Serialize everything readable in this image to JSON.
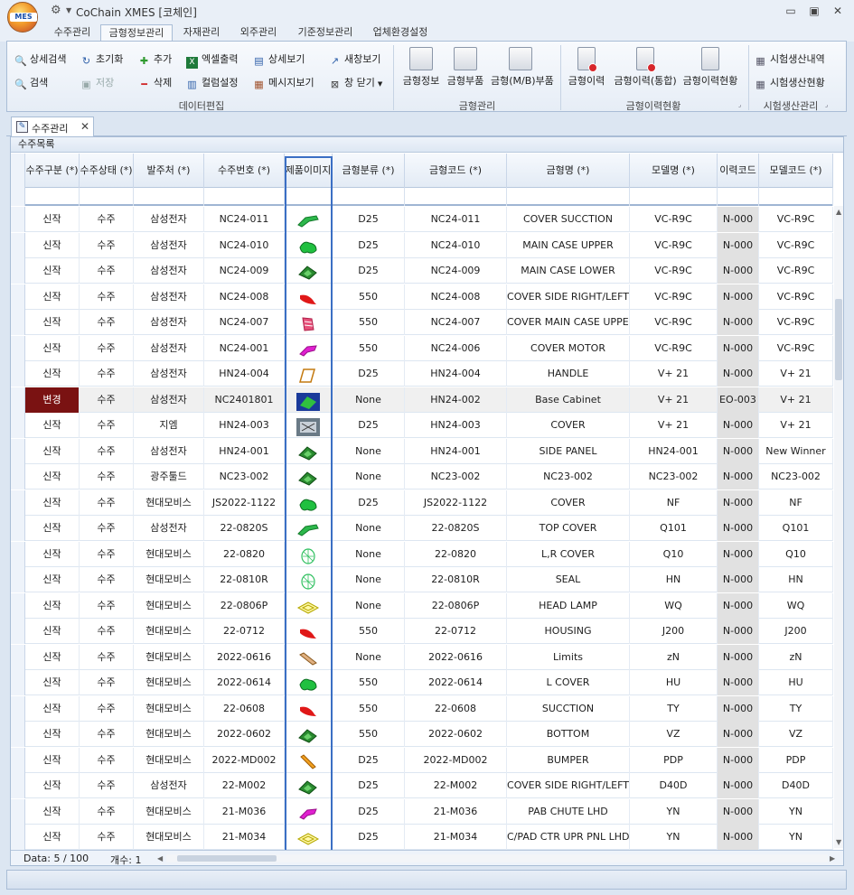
{
  "window": {
    "logo_text": "MES",
    "title": "CoChain XMES [코체인]"
  },
  "ribbon_tabs": [
    "수주관리",
    "금형정보관리",
    "자재관리",
    "외주관리",
    "기준정보관리",
    "업체환경설정"
  ],
  "ribbon": {
    "search_detail": "상세검색",
    "search": "검색",
    "reset": "초기화",
    "save": "저장",
    "add": "추가",
    "delete": "삭제",
    "excel_export": "엑셀출력",
    "column_settings": "컬럼설정",
    "detail_view": "상세보기",
    "message_view": "메시지보기",
    "new_window": "새창보기",
    "close_window": "창 닫기",
    "group_data_edit": "데이터편집",
    "mold_info": "금형정보",
    "mold_parts": "금형부품",
    "mold_mb_parts": "금형(M/B)부품",
    "group_mold_mgmt": "금형관리",
    "mold_history": "금형이력",
    "mold_history_integrated": "금형이력(통합)",
    "mold_history_status": "금형이력현황",
    "group_mold_history": "금형이력현황",
    "trial_production_log": "시험생산내역",
    "trial_production_status": "시험생산현황",
    "group_trial": "시험생산관리"
  },
  "doc_tab": {
    "label": "수주관리"
  },
  "panel": {
    "title": "수주목록"
  },
  "columns": [
    "수주구분 (*)",
    "수주상태 (*)",
    "발주처 (*)",
    "수주번호 (*)",
    "제품이미지",
    "금형분류 (*)",
    "금형코드 (*)",
    "금형명 (*)",
    "모델명 (*)",
    "이력코드",
    "모델코드 (*)"
  ],
  "rows": [
    {
      "type": "신작",
      "status": "수주",
      "client": "삼성전자",
      "order_no": "NC24-011",
      "image": "green-arm",
      "mold_class": "D25",
      "mold_code": "NC24-011",
      "mold_name": "COVER SUCCTION",
      "model": "VC-R9C",
      "history": "N-000",
      "model_code": "VC-R9C"
    },
    {
      "type": "신작",
      "status": "수주",
      "client": "삼성전자",
      "order_no": "NC24-010",
      "image": "green-blob",
      "mold_class": "D25",
      "mold_code": "NC24-010",
      "mold_name": "MAIN CASE UPPER",
      "model": "VC-R9C",
      "history": "N-000",
      "model_code": "VC-R9C"
    },
    {
      "type": "신작",
      "status": "수주",
      "client": "삼성전자",
      "order_no": "NC24-009",
      "image": "green-dark",
      "mold_class": "D25",
      "mold_code": "NC24-009",
      "mold_name": "MAIN CASE LOWER",
      "model": "VC-R9C",
      "history": "N-000",
      "model_code": "VC-R9C"
    },
    {
      "type": "신작",
      "status": "수주",
      "client": "삼성전자",
      "order_no": "NC24-008",
      "image": "red-part",
      "mold_class": "550",
      "mold_code": "NC24-008",
      "mold_name": "COVER SIDE RIGHT/LEFT",
      "model": "VC-R9C",
      "history": "N-000",
      "model_code": "VC-R9C"
    },
    {
      "type": "신작",
      "status": "수주",
      "client": "삼성전자",
      "order_no": "NC24-007",
      "image": "red-mesh",
      "mold_class": "550",
      "mold_code": "NC24-007",
      "mold_name": "COVER MAIN CASE UPPER",
      "model": "VC-R9C",
      "history": "N-000",
      "model_code": "VC-R9C"
    },
    {
      "type": "신작",
      "status": "수주",
      "client": "삼성전자",
      "order_no": "NC24-001",
      "image": "magenta",
      "mold_class": "550",
      "mold_code": "NC24-006",
      "mold_name": "COVER MOTOR",
      "model": "VC-R9C",
      "history": "N-000",
      "model_code": "VC-R9C"
    },
    {
      "type": "신작",
      "status": "수주",
      "client": "삼성전자",
      "order_no": "HN24-004",
      "image": "outline-orange",
      "mold_class": "D25",
      "mold_code": "HN24-004",
      "mold_name": "HANDLE",
      "model": "V+ 21",
      "history": "N-000",
      "model_code": "V+ 21"
    },
    {
      "type": "변경",
      "status": "수주",
      "client": "삼성전자",
      "order_no": "NC2401801",
      "image": "photo-blue",
      "mold_class": "None",
      "mold_code": "HN24-002",
      "mold_name": "Base Cabinet",
      "model": "V+ 21",
      "history": "EO-003",
      "model_code": "V+ 21"
    },
    {
      "type": "신작",
      "status": "수주",
      "client": "지엠",
      "order_no": "HN24-003",
      "image": "photo-gray",
      "mold_class": "D25",
      "mold_code": "HN24-003",
      "mold_name": "COVER",
      "model": "V+ 21",
      "history": "N-000",
      "model_code": "V+ 21"
    },
    {
      "type": "신작",
      "status": "수주",
      "client": "삼성전자",
      "order_no": "HN24-001",
      "image": "green-dark",
      "mold_class": "None",
      "mold_code": "HN24-001",
      "mold_name": "SIDE PANEL",
      "model": "HN24-001",
      "history": "N-000",
      "model_code": "New Winner"
    },
    {
      "type": "신작",
      "status": "수주",
      "client": "광주툴드",
      "order_no": "NC23-002",
      "image": "green-dark",
      "mold_class": "None",
      "mold_code": "NC23-002",
      "mold_name": "NC23-002",
      "model": "NC23-002",
      "history": "N-000",
      "model_code": "NC23-002"
    },
    {
      "type": "신작",
      "status": "수주",
      "client": "현대모비스",
      "order_no": "JS2022-1122",
      "image": "green-blob",
      "mold_class": "D25",
      "mold_code": "JS2022-1122",
      "mold_name": "COVER",
      "model": "NF",
      "history": "N-000",
      "model_code": "NF"
    },
    {
      "type": "신작",
      "status": "수주",
      "client": "삼성전자",
      "order_no": "22-0820S",
      "image": "green-arm",
      "mold_class": "None",
      "mold_code": "22-0820S",
      "mold_name": "TOP COVER",
      "model": "Q101",
      "history": "N-000",
      "model_code": "Q101"
    },
    {
      "type": "신작",
      "status": "수주",
      "client": "현대모비스",
      "order_no": "22-0820",
      "image": "green-wire",
      "mold_class": "None",
      "mold_code": "22-0820",
      "mold_name": "L,R COVER",
      "model": "Q10",
      "history": "N-000",
      "model_code": "Q10"
    },
    {
      "type": "신작",
      "status": "수주",
      "client": "현대모비스",
      "order_no": "22-0810R",
      "image": "green-wire",
      "mold_class": "None",
      "mold_code": "22-0810R",
      "mold_name": "SEAL",
      "model": "HN",
      "history": "N-000",
      "model_code": "HN"
    },
    {
      "type": "신작",
      "status": "수주",
      "client": "현대모비스",
      "order_no": "22-0806P",
      "image": "yellow-wire",
      "mold_class": "None",
      "mold_code": "22-0806P",
      "mold_name": "HEAD LAMP",
      "model": "WQ",
      "history": "N-000",
      "model_code": "WQ"
    },
    {
      "type": "신작",
      "status": "수주",
      "client": "현대모비스",
      "order_no": "22-0712",
      "image": "red-part",
      "mold_class": "550",
      "mold_code": "22-0712",
      "mold_name": "HOUSING",
      "model": "J200",
      "history": "N-000",
      "model_code": "J200"
    },
    {
      "type": "신작",
      "status": "수주",
      "client": "현대모비스",
      "order_no": "2022-0616",
      "image": "tan-bar",
      "mold_class": "None",
      "mold_code": "2022-0616",
      "mold_name": "Limits",
      "model": "zN",
      "history": "N-000",
      "model_code": "zN"
    },
    {
      "type": "신작",
      "status": "수주",
      "client": "현대모비스",
      "order_no": "2022-0614",
      "image": "green-blob",
      "mold_class": "550",
      "mold_code": "2022-0614",
      "mold_name": "L COVER",
      "model": "HU",
      "history": "N-000",
      "model_code": "HU"
    },
    {
      "type": "신작",
      "status": "수주",
      "client": "현대모비스",
      "order_no": "22-0608",
      "image": "red-part",
      "mold_class": "550",
      "mold_code": "22-0608",
      "mold_name": "SUCCTION",
      "model": "TY",
      "history": "N-000",
      "model_code": "TY"
    },
    {
      "type": "신작",
      "status": "수주",
      "client": "현대모비스",
      "order_no": "2022-0602",
      "image": "green-dark",
      "mold_class": "550",
      "mold_code": "2022-0602",
      "mold_name": "BOTTOM",
      "model": "VZ",
      "history": "N-000",
      "model_code": "VZ"
    },
    {
      "type": "신작",
      "status": "수주",
      "client": "현대모비스",
      "order_no": "2022-MD002",
      "image": "orange-bar",
      "mold_class": "D25",
      "mold_code": "2022-MD002",
      "mold_name": "BUMPER",
      "model": "PDP",
      "history": "N-000",
      "model_code": "PDP"
    },
    {
      "type": "신작",
      "status": "수주",
      "client": "삼성전자",
      "order_no": "22-M002",
      "image": "green-dark",
      "mold_class": "D25",
      "mold_code": "22-M002",
      "mold_name": "COVER SIDE RIGHT/LEFT",
      "model": "D40D",
      "history": "N-000",
      "model_code": "D40D"
    },
    {
      "type": "신작",
      "status": "수주",
      "client": "현대모비스",
      "order_no": "21-M036",
      "image": "magenta",
      "mold_class": "D25",
      "mold_code": "21-M036",
      "mold_name": "PAB CHUTE LHD",
      "model": "YN",
      "history": "N-000",
      "model_code": "YN"
    },
    {
      "type": "신작",
      "status": "수주",
      "client": "현대모비스",
      "order_no": "21-M034",
      "image": "yellow-wire",
      "mold_class": "D25",
      "mold_code": "21-M034",
      "mold_name": "C/PAD CTR UPR PNL LHD",
      "model": "YN",
      "history": "N-000",
      "model_code": "YN"
    }
  ],
  "status": {
    "data_label": "Data: 5 / 100",
    "count_label": "개수: 1"
  },
  "colors": {
    "accent": "#3b6fc4",
    "changed_bg": "#7a1212",
    "history_bg": "#e1e1e1"
  }
}
